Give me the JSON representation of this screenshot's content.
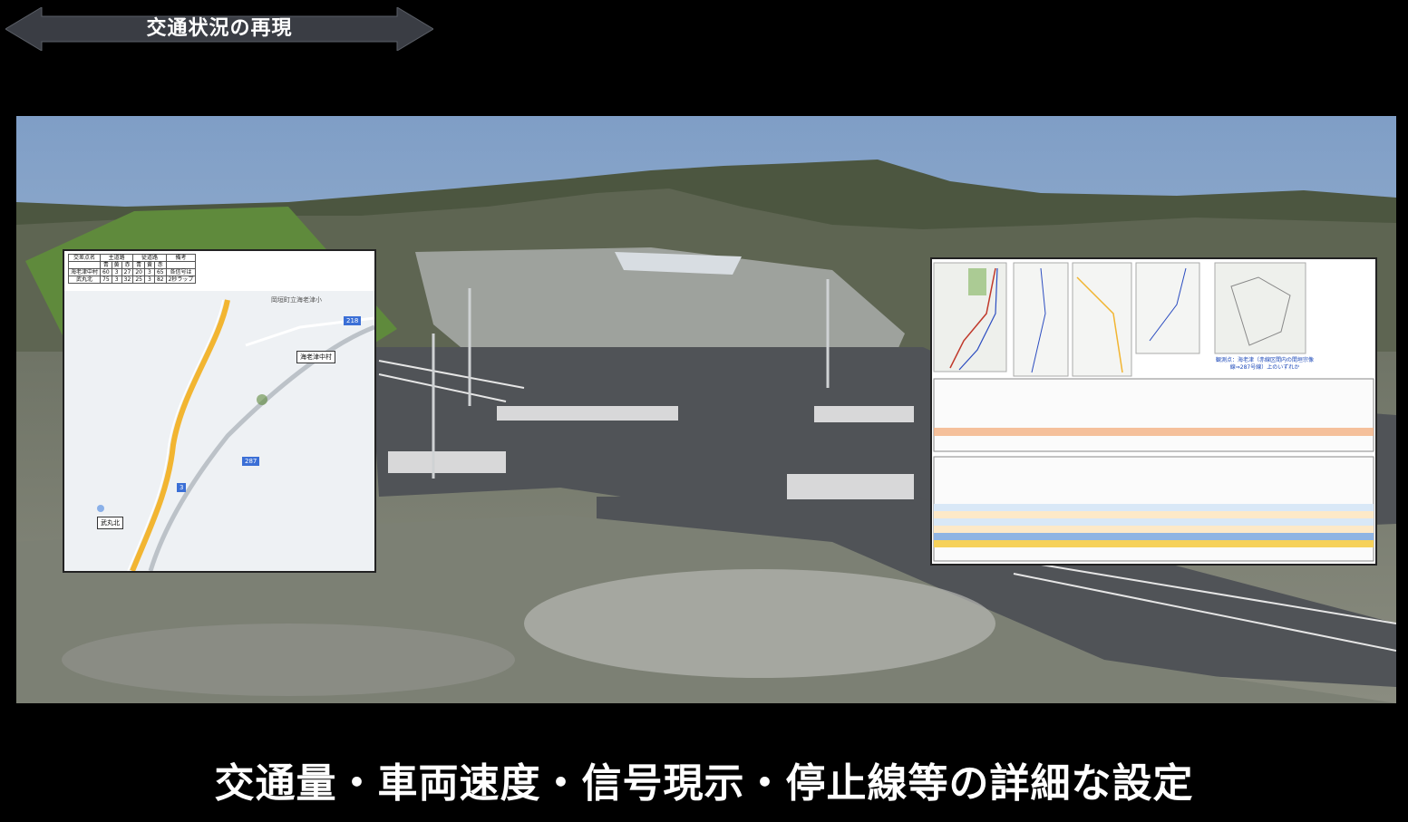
{
  "header": {
    "banner_text": "交通状況の再現"
  },
  "left_panel": {
    "table": {
      "headers_top": [
        "交差点名",
        "主道路",
        "",
        "",
        "従道路",
        "",
        "",
        "備考"
      ],
      "headers_sub": [
        "",
        "青",
        "黄",
        "赤",
        "青",
        "黄",
        "赤",
        ""
      ],
      "rows": [
        [
          "海老津中村",
          "60",
          "3",
          "27",
          "20",
          "3",
          "65",
          "各信号は"
        ],
        [
          "武丸北",
          "75",
          "3",
          "32",
          "25",
          "3",
          "82",
          "2秒ラップ"
        ]
      ]
    },
    "map": {
      "school_label": "岡垣町立海老津小",
      "marker_top": "海老津中村",
      "marker_bottom": "武丸北",
      "route_badge_1": "3",
      "route_badge_2": "287",
      "route_badge_3": "218"
    }
  },
  "right_panel": {
    "note_line1": "観測点：海老津（赤線区間内の間垣宗像",
    "note_line2": "線⇒287号線）上のいずれか"
  },
  "footer": {
    "caption": "交通量・車両速度・信号現示・停止線等の詳細な設定"
  }
}
